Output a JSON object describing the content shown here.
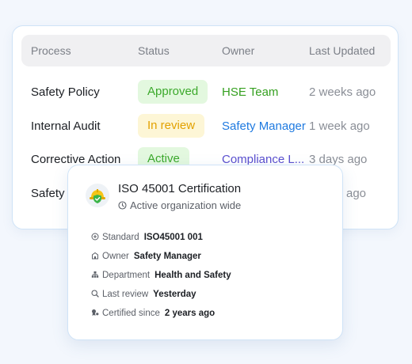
{
  "table": {
    "headers": [
      "Process",
      "Status",
      "Owner",
      "Last Updated"
    ],
    "rows": [
      {
        "process": "Safety Policy",
        "status": "Approved",
        "owner": "HSE Team",
        "updated": "2 weeks ago"
      },
      {
        "process": "Internal Audit",
        "status": "In review",
        "owner": "Safety Manager",
        "updated": "1 week ago"
      },
      {
        "process": "Corrective Action",
        "status": "Active",
        "owner": "Compliance L...",
        "updated": "3 days ago"
      },
      {
        "process": "Safety",
        "updated": "ago"
      }
    ]
  },
  "colors": {
    "owner_green": "#35a020",
    "owner_blue": "#1f7ae0",
    "owner_purple": "#5a4fcf",
    "status_green": "#3ca92c",
    "status_amber": "#e2a100"
  },
  "popup": {
    "title": "ISO 45001 Certification",
    "subtitle": "Active organization wide",
    "icon": "safety-helmet-icon",
    "details": [
      {
        "icon": "standard-icon",
        "label": "Standard",
        "value": "ISO45001 001"
      },
      {
        "icon": "owner-icon",
        "label": "Owner",
        "value": "Safety Manager"
      },
      {
        "icon": "department-icon",
        "label": "Department",
        "value": "Health and Safety"
      },
      {
        "icon": "review-icon",
        "label": "Last review",
        "value": "Yesterday"
      },
      {
        "icon": "certified-icon",
        "label": "Certified since",
        "value": "2 years ago"
      }
    ]
  }
}
